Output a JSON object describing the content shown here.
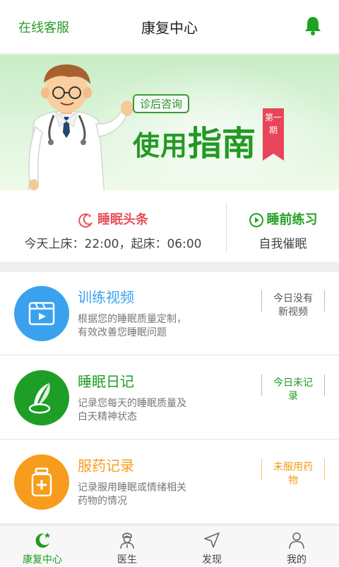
{
  "header": {
    "left_link": "在线客服",
    "title": "康复中心",
    "bell_icon": "bell-icon"
  },
  "banner": {
    "tag": "诊后咨询",
    "headline_part1": "使用",
    "headline_part2": "指南",
    "issue": "第一期"
  },
  "sleep": {
    "headline": "睡眠头条",
    "times": "今天上床：22:00，起床：06:00",
    "practice_headline": "睡前练习",
    "practice_sub": "自我催眠"
  },
  "cards": [
    {
      "title": "训练视频",
      "desc_line1": "根据您的睡眠质量定制，",
      "desc_line2": "有效改善您睡眠问题",
      "status_line1": "今日没有",
      "status_line2": "新视频",
      "color": "#3aa1ef",
      "icon": "video-icon"
    },
    {
      "title": "睡眠日记",
      "desc_line1": "记录您每天的睡眠质量及",
      "desc_line2": "白天精神状态",
      "status_line1": "今日未记",
      "status_line2": "录",
      "color": "#1e9e26",
      "icon": "feather-pen-icon"
    },
    {
      "title": "服药记录",
      "desc_line1": "记录服用睡眠或情绪相关",
      "desc_line2": "药物的情况",
      "status_line1": "未服用药",
      "status_line2": "物",
      "color": "#f79c1c",
      "icon": "medicine-bottle-icon"
    }
  ],
  "tabs": [
    {
      "label": "康复中心",
      "icon": "moon-star-icon",
      "active": true
    },
    {
      "label": "医生",
      "icon": "doctor-icon",
      "active": false
    },
    {
      "label": "发现",
      "icon": "navigation-arrow-icon",
      "active": false
    },
    {
      "label": "我的",
      "icon": "user-icon",
      "active": false
    }
  ],
  "colors": {
    "brand_green": "#2a9a2a",
    "sleep_red": "#e5515a"
  }
}
